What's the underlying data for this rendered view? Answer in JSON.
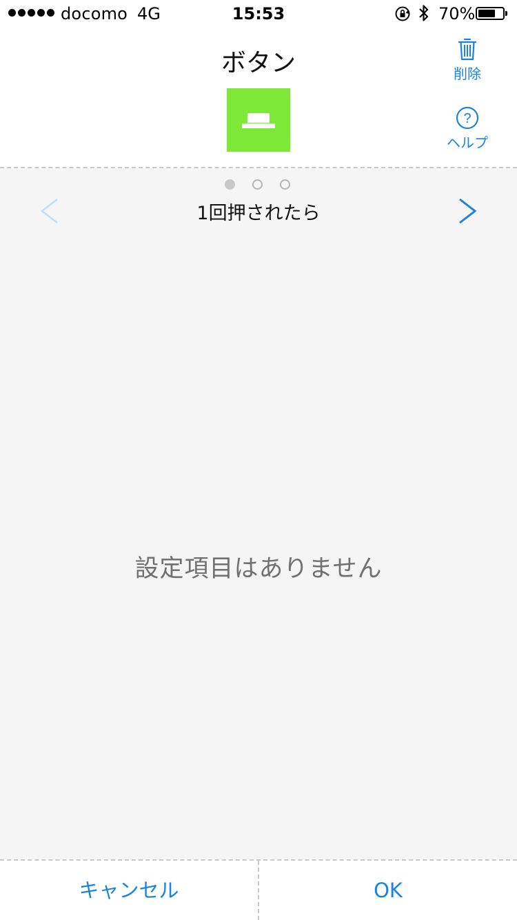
{
  "status_bar": {
    "carrier": "docomo",
    "network": "4G",
    "time": "15:53",
    "battery_percent": "70%",
    "battery_level": 0.7,
    "signal_bars": 5
  },
  "header": {
    "title": "ボタン",
    "device_icon": "button-device-icon",
    "device_color": "#7ee837",
    "delete_label": "削除",
    "help_label": "ヘルプ"
  },
  "pager": {
    "dots": 3,
    "active_index": 0,
    "caption": "1回押されたら"
  },
  "content": {
    "empty_message": "設定項目はありません"
  },
  "footer": {
    "cancel_label": "キャンセル",
    "ok_label": "OK"
  },
  "colors": {
    "accent": "#1a83e0",
    "disabled_accent": "#c2ddf7",
    "panel_background": "#f5f5f5"
  }
}
